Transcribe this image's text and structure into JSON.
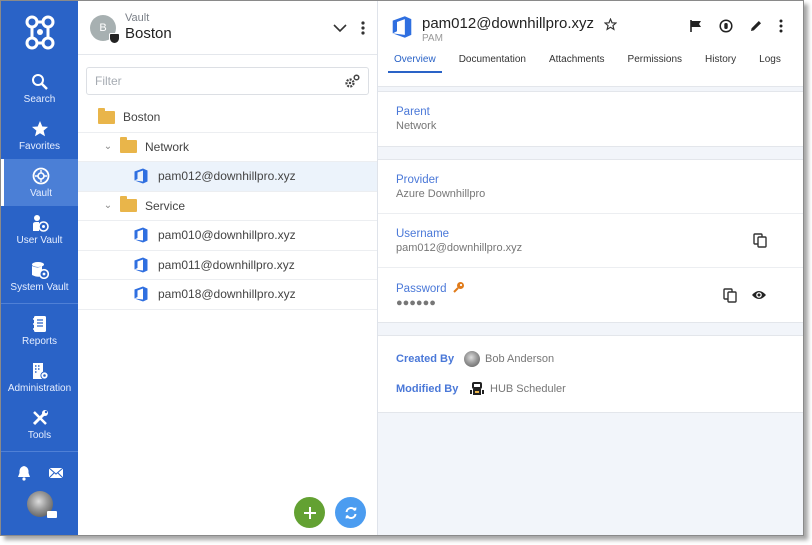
{
  "nav": {
    "items": [
      {
        "label": "Search",
        "icon": "search-icon"
      },
      {
        "label": "Favorites",
        "icon": "star-icon"
      },
      {
        "label": "Vault",
        "icon": "vault-icon",
        "active": true
      },
      {
        "label": "User Vault",
        "icon": "user-vault-icon"
      },
      {
        "label": "System Vault",
        "icon": "system-vault-icon"
      },
      {
        "label": "Reports",
        "icon": "reports-icon"
      },
      {
        "label": "Administration",
        "icon": "administration-icon"
      },
      {
        "label": "Tools",
        "icon": "tools-icon"
      }
    ],
    "colors": {
      "rail": "#2a63c7",
      "active": "#4b7fd6"
    }
  },
  "vault": {
    "avatar_letter": "B",
    "sub": "Vault",
    "name": "Boston"
  },
  "filter": {
    "placeholder": "Filter",
    "value": ""
  },
  "tree": [
    {
      "label": "Boston",
      "type": "root-folder",
      "level": 0
    },
    {
      "label": "Network",
      "type": "folder",
      "level": 1,
      "expanded": true
    },
    {
      "label": "pam012@downhillpro.xyz",
      "type": "entry",
      "level": 2,
      "selected": true
    },
    {
      "label": "Service",
      "type": "folder",
      "level": 1,
      "expanded": true
    },
    {
      "label": "pam010@downhillpro.xyz",
      "type": "entry",
      "level": 2
    },
    {
      "label": "pam011@downhillpro.xyz",
      "type": "entry",
      "level": 2
    },
    {
      "label": "pam018@downhillpro.xyz",
      "type": "entry",
      "level": 2
    }
  ],
  "fab": {
    "add": "+",
    "refresh": "refresh"
  },
  "entry": {
    "title": "pam012@downhillpro.xyz",
    "subtitle": "PAM",
    "tabs": [
      "Overview",
      "Documentation",
      "Attachments",
      "Permissions",
      "History",
      "Logs"
    ],
    "active_tab": "Overview",
    "parent": {
      "label": "Parent",
      "value": "Network"
    },
    "provider": {
      "label": "Provider",
      "value": "Azure Downhillpro"
    },
    "username": {
      "label": "Username",
      "value": "pam012@downhillpro.xyz"
    },
    "password": {
      "label": "Password",
      "value": "●●●●●●"
    },
    "created_by": {
      "label": "Created By",
      "value": "Bob Anderson"
    },
    "modified_by": {
      "label": "Modified By",
      "value": "HUB Scheduler"
    }
  },
  "colors": {
    "accent": "#2a63c7",
    "label": "#4a78d8",
    "password": "#e07b1a",
    "add": "#63a132",
    "refresh": "#4b9cf0"
  }
}
